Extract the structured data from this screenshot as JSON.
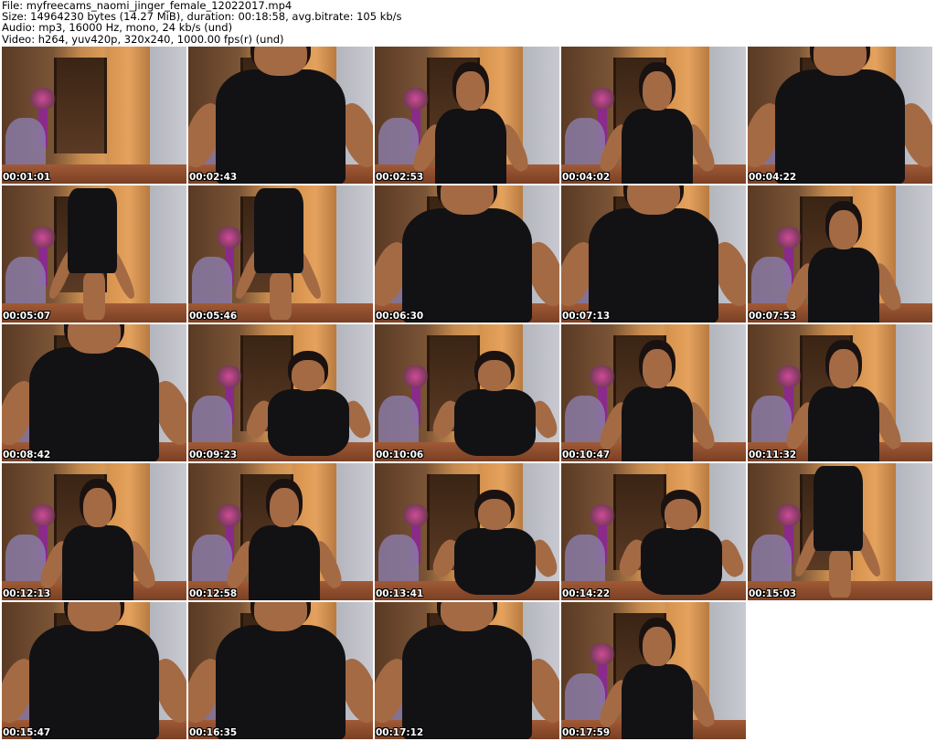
{
  "header": {
    "line1": "File: myfreecams_naomi_jinger_female_12022017.mp4",
    "line2": "Size: 14964230 bytes (14.27 MiB), duration: 00:18:58, avg.bitrate: 105 kb/s",
    "line3": "Audio: mp3, 16000 Hz, mono, 24 kb/s (und)",
    "line4": "Video: h264, yuv420p, 320x240, 1000.00 fps(r) (und)"
  },
  "thumbnails": [
    {
      "time": "00:01:01",
      "pose": "empty"
    },
    {
      "time": "00:02:43",
      "pose": "close"
    },
    {
      "time": "00:02:53",
      "pose": "mid"
    },
    {
      "time": "00:04:02",
      "pose": "mid"
    },
    {
      "time": "00:04:22",
      "pose": "close"
    },
    {
      "time": "00:05:07",
      "pose": "standing"
    },
    {
      "time": "00:05:46",
      "pose": "standing"
    },
    {
      "time": "00:06:30",
      "pose": "close"
    },
    {
      "time": "00:07:13",
      "pose": "close"
    },
    {
      "time": "00:07:53",
      "pose": "mid"
    },
    {
      "time": "00:08:42",
      "pose": "close"
    },
    {
      "time": "00:09:23",
      "pose": "seated"
    },
    {
      "time": "00:10:06",
      "pose": "seated"
    },
    {
      "time": "00:10:47",
      "pose": "mid"
    },
    {
      "time": "00:11:32",
      "pose": "mid"
    },
    {
      "time": "00:12:13",
      "pose": "mid"
    },
    {
      "time": "00:12:58",
      "pose": "mid"
    },
    {
      "time": "00:13:41",
      "pose": "seated"
    },
    {
      "time": "00:14:22",
      "pose": "seated"
    },
    {
      "time": "00:15:03",
      "pose": "standing"
    },
    {
      "time": "00:15:47",
      "pose": "close"
    },
    {
      "time": "00:16:35",
      "pose": "close"
    },
    {
      "time": "00:17:12",
      "pose": "close"
    },
    {
      "time": "00:17:59",
      "pose": "mid"
    }
  ]
}
